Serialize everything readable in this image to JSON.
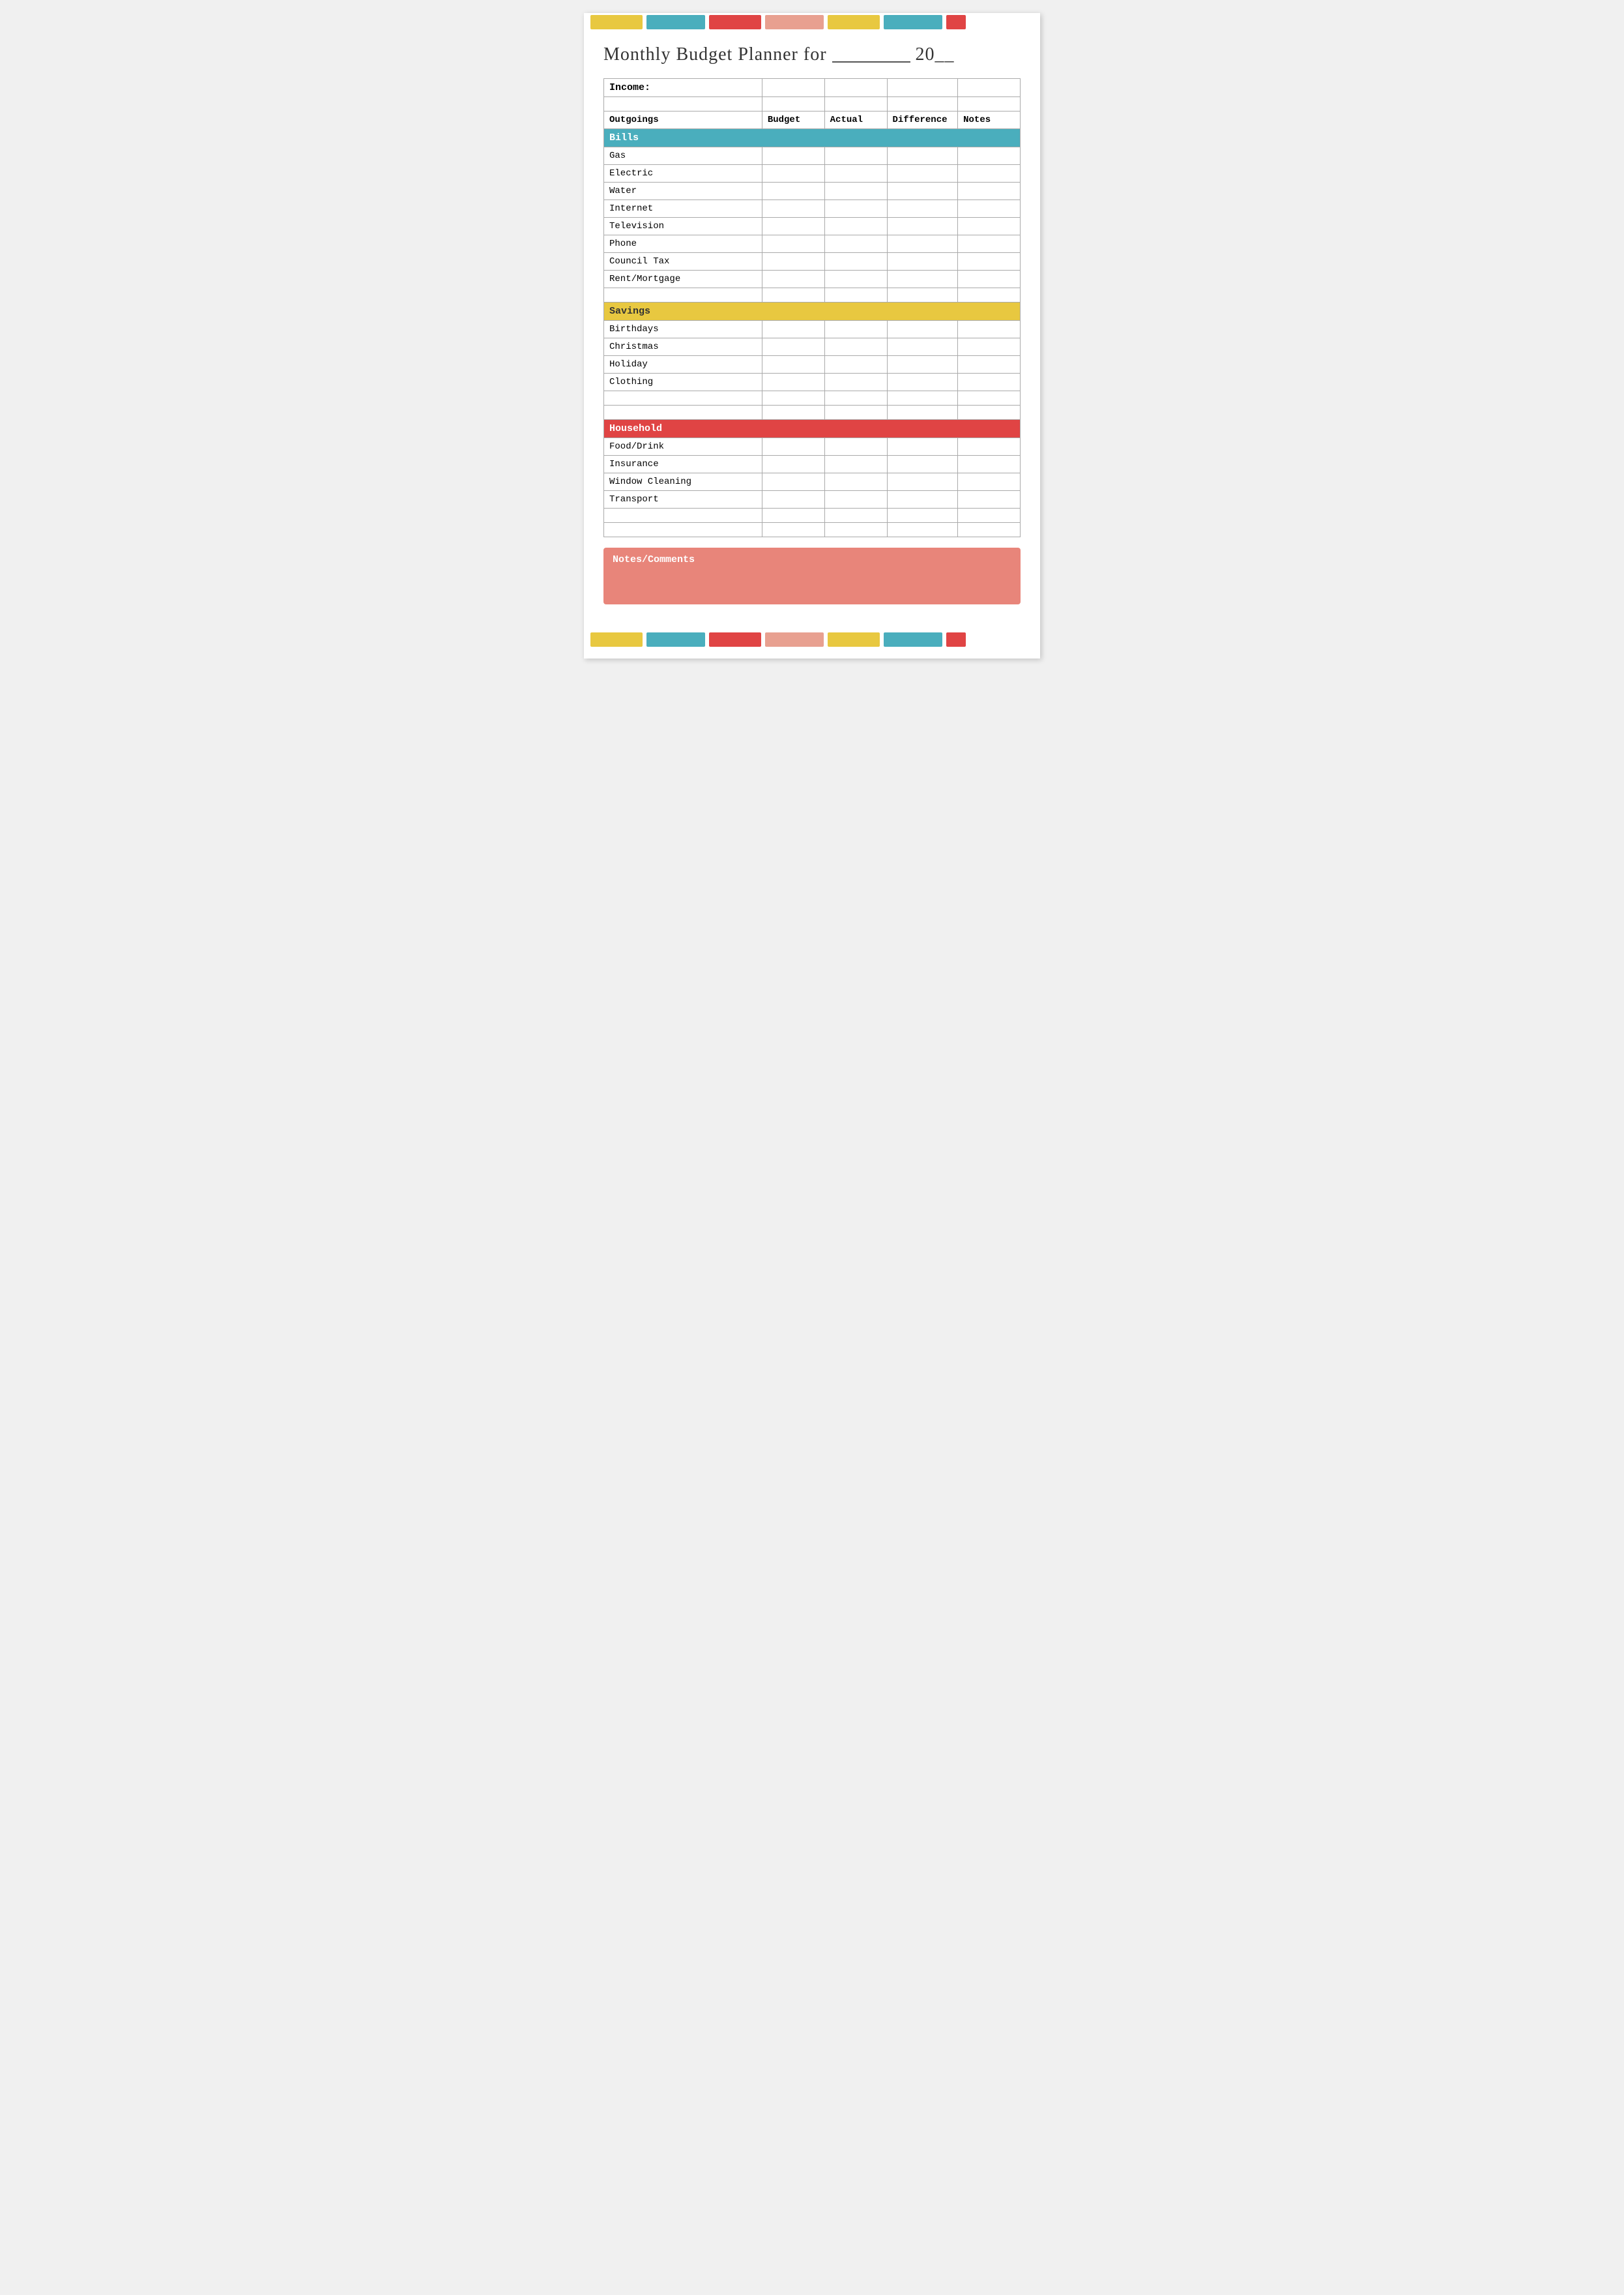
{
  "topBars": [
    {
      "color": "yellow",
      "class": "bar-yellow bar-1"
    },
    {
      "color": "blue",
      "class": "bar-blue bar-2"
    },
    {
      "color": "red",
      "class": "bar-red bar-3"
    },
    {
      "color": "salmon",
      "class": "bar-salmon bar-4"
    },
    {
      "color": "yellow",
      "class": "bar-yellow bar-5"
    },
    {
      "color": "blue",
      "class": "bar-blue bar-6"
    },
    {
      "color": "red",
      "class": "bar-red bar-7"
    }
  ],
  "title": {
    "prefix": "Monthly Budget Planner for ",
    "underline": "_________",
    "year": " 20__"
  },
  "table": {
    "incomeLabel": "Income:",
    "headers": {
      "outgoings": "Outgoings",
      "budget": "Budget",
      "actual": "Actual",
      "difference": "Difference",
      "notes": "Notes"
    },
    "sections": {
      "bills": {
        "label": "Bills",
        "items": [
          "Gas",
          "Electric",
          "Water",
          "Internet",
          "Television",
          "Phone",
          "Council Tax",
          "Rent/Mortgage"
        ]
      },
      "savings": {
        "label": "Savings",
        "items": [
          "Birthdays",
          "Christmas",
          "Holiday",
          "Clothing"
        ]
      },
      "household": {
        "label": "Household",
        "items": [
          "Food/Drink",
          "Insurance",
          "Window Cleaning",
          "Transport"
        ]
      }
    }
  },
  "notes": {
    "label": "Notes/Comments"
  }
}
